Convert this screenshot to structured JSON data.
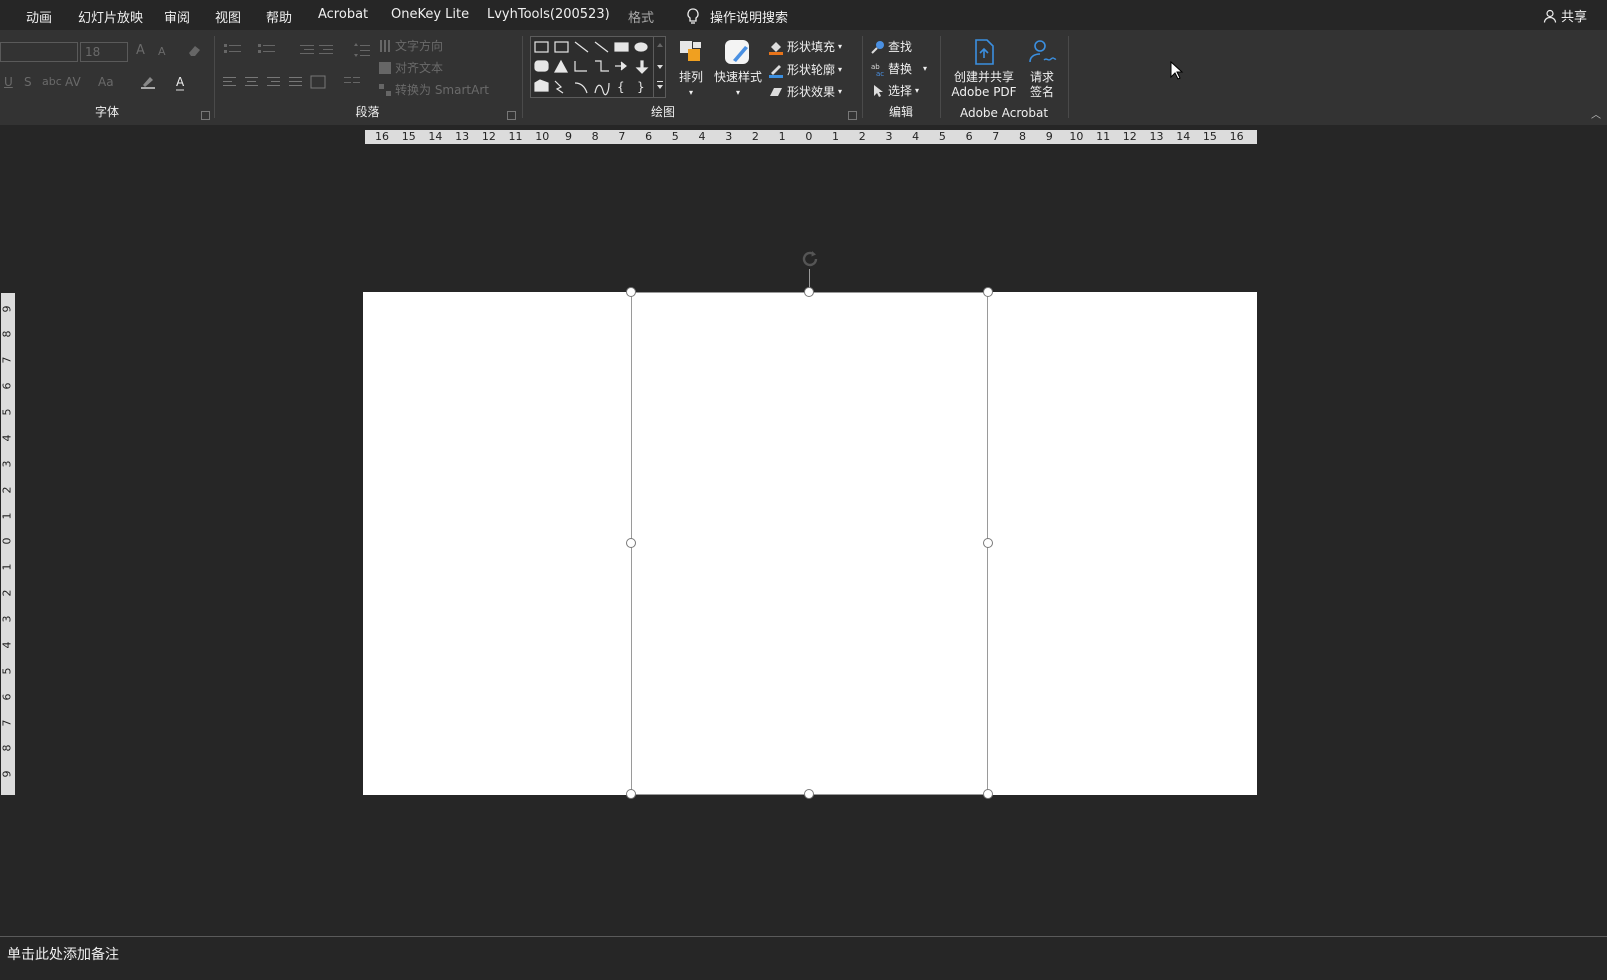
{
  "menu": {
    "items": [
      "动画",
      "幻灯片放映",
      "审阅",
      "视图",
      "帮助",
      "Acrobat",
      "OneKey Lite",
      "LvyhTools(200523)"
    ],
    "context_tab": "格式",
    "search_label": "操作说明搜索",
    "share_label": "共享"
  },
  "ribbon": {
    "font": {
      "label": "字体",
      "size_value": "18",
      "grow_label": "A",
      "shrink_label": "A",
      "abc_label": "abc",
      "av_label": "AV",
      "aa_label": "Aa",
      "color_label": "A",
      "underline": "U",
      "strike": "S"
    },
    "paragraph": {
      "label": "段落",
      "text_direction": "文字方向",
      "align_text": "对齐文本",
      "convert_smartart": "转换为 SmartArt"
    },
    "drawing": {
      "label": "绘图",
      "arrange": "排列",
      "quick_styles": "快速样式",
      "shape_fill": "形状填充",
      "shape_outline": "形状轮廓",
      "shape_effects": "形状效果"
    },
    "editing": {
      "label": "编辑",
      "find": "查找",
      "replace": "替换",
      "select": "选择"
    },
    "acrobat": {
      "label": "Adobe Acrobat",
      "create_share_line1": "创建并共享",
      "create_share_line2": "Adobe PDF",
      "request_sign_line1": "请求",
      "request_sign_line2": "签名"
    }
  },
  "ruler": {
    "horizontal": [
      "16",
      "15",
      "14",
      "13",
      "12",
      "11",
      "10",
      "9",
      "8",
      "7",
      "6",
      "5",
      "4",
      "3",
      "2",
      "1",
      "0",
      "1",
      "2",
      "3",
      "4",
      "5",
      "6",
      "7",
      "8",
      "9",
      "10",
      "11",
      "12",
      "13",
      "14",
      "15",
      "16"
    ],
    "vertical": [
      "9",
      "8",
      "7",
      "6",
      "5",
      "4",
      "3",
      "2",
      "1",
      "0",
      "1",
      "2",
      "3",
      "4",
      "5",
      "6",
      "7",
      "8",
      "9"
    ]
  },
  "notes": {
    "placeholder": "单击此处添加备注"
  },
  "colors": {
    "background": "#262626",
    "ribbon": "#333333",
    "accent_blue": "#3b8fe0",
    "slide": "#ffffff"
  }
}
